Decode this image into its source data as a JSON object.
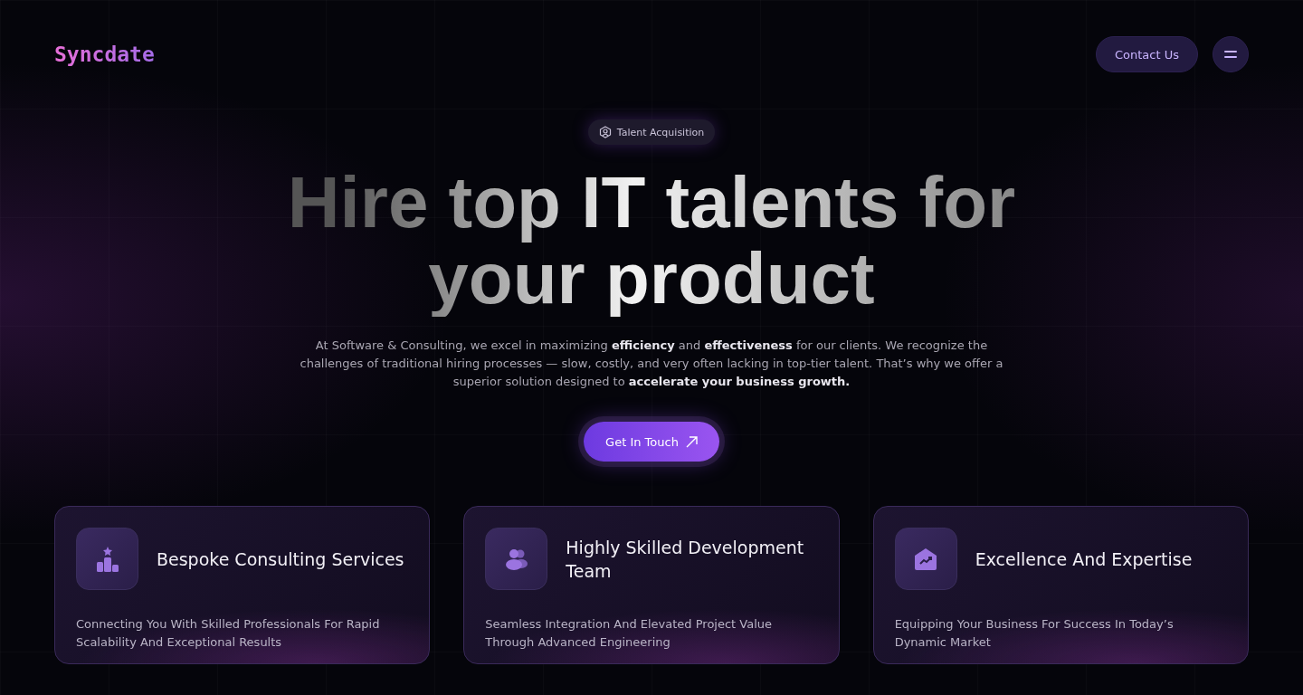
{
  "nav": {
    "logo": "Syncdate",
    "contact_button": "Contact Us"
  },
  "hero": {
    "badge": "Talent Acquisition",
    "headline": "Hire top IT talents for your product",
    "description": "At Software & Consulting, we excel in maximizing **efficiency** and **effectiveness** for our clients. We recognize the challenges of traditional hiring processes — slow, costly, and very often lacking in top-tier talent. That’s why we offer a superior solution designed to **accelerate your business growth.**",
    "cta": "Get In Touch"
  },
  "cards": [
    {
      "kind": "podium",
      "title": "Bespoke Consulting Services",
      "text": "Connecting You With Skilled Professionals For Rapid Scalability And Exceptional Results"
    },
    {
      "kind": "team",
      "title": "Highly Skilled Development Team",
      "text": "Seamless Integration And Elevated Project Value Through Advanced Engineering"
    },
    {
      "kind": "growth",
      "title": "Excellence And Expertise",
      "text": "Equipping Your Business For Success In Today’s Dynamic Market"
    }
  ]
}
